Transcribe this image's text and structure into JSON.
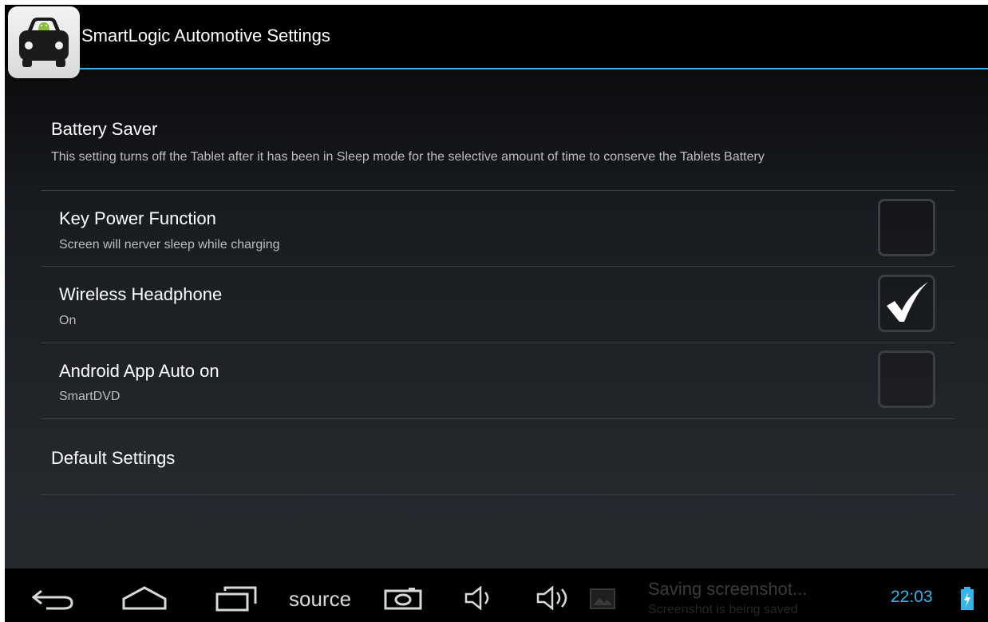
{
  "app": {
    "title": "SmartLogic Automotive Settings",
    "icon": "car-app-icon"
  },
  "preferences": [
    {
      "title": "Battery Saver",
      "summary": "This setting turns off the Tablet after it has been in Sleep mode for the selective amount of time to conserve the Tablets Battery"
    },
    {
      "title": "Key Power Function",
      "summary": "Screen will nerver sleep while charging",
      "checked": false
    },
    {
      "title": "Wireless Headphone",
      "summary": "On",
      "checked": true
    },
    {
      "title": "Android App Auto on",
      "summary": "SmartDVD",
      "checked": false
    },
    {
      "title": "Default Settings"
    }
  ],
  "navbar": {
    "icons": [
      "back-icon",
      "home-icon",
      "recent-apps-icon",
      "camera-icon",
      "volume-down-icon",
      "volume-up-icon",
      "gallery-icon",
      "battery-charging-icon"
    ],
    "source_label": "source",
    "notification_title": "Saving screenshot...",
    "notification_text": "Screenshot is being saved",
    "clock": "22:03"
  },
  "colors": {
    "accent": "#33b5e5",
    "background_top": "#000000",
    "background_bottom": "#262a2f",
    "checkbox_border": "#3a3f46"
  }
}
